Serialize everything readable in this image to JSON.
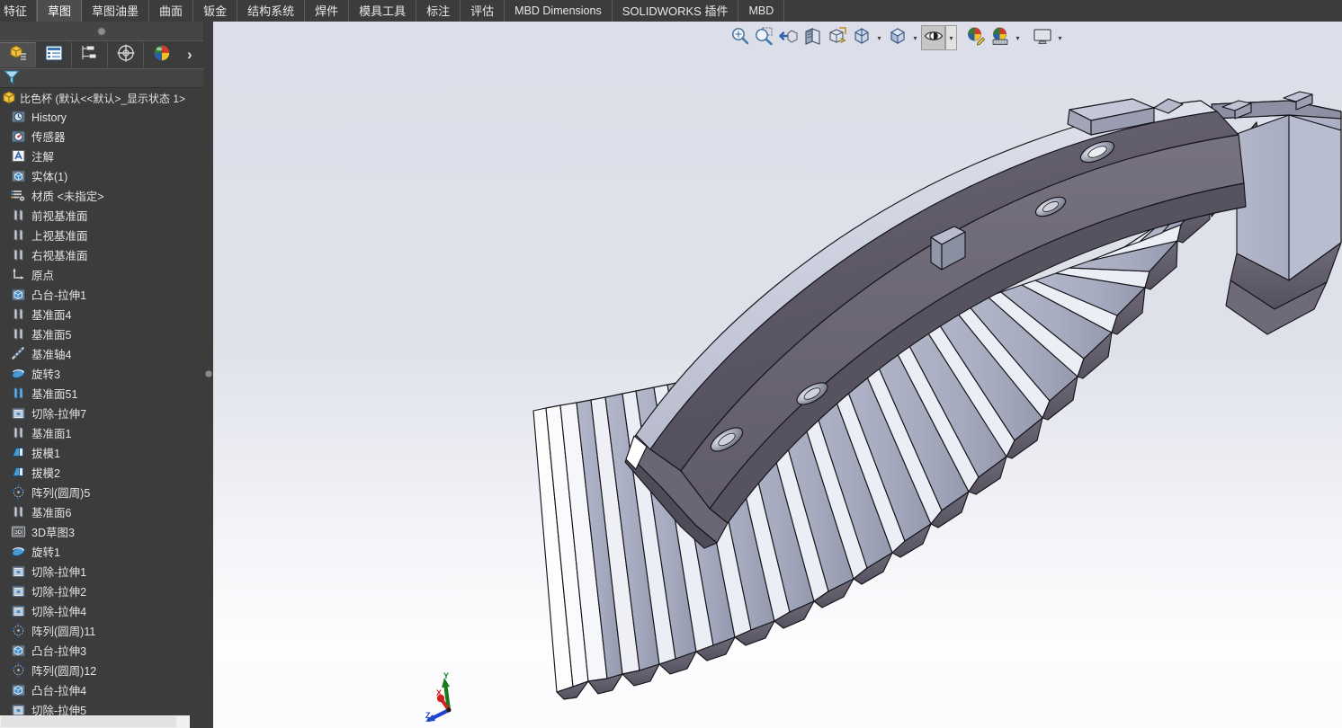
{
  "app": {
    "name": "SOLIDWORKS",
    "accent_blue": "#4a90d9",
    "panel_bg": "#3c3c3c",
    "viewport_top": "#dcdfe9",
    "viewport_bottom": "#fdfdfe",
    "model_dark": "#5f5a68",
    "model_light": "#adb1c5",
    "model_mid": "#8f93a8"
  },
  "ribbon": {
    "tabs": [
      {
        "label": "特征",
        "active": false,
        "script": "cjk"
      },
      {
        "label": "草图",
        "active": true,
        "script": "cjk"
      },
      {
        "label": "草图油墨",
        "active": false,
        "script": "cjk"
      },
      {
        "label": "曲面",
        "active": false,
        "script": "cjk"
      },
      {
        "label": "钣金",
        "active": false,
        "script": "cjk"
      },
      {
        "label": "结构系统",
        "active": false,
        "script": "cjk"
      },
      {
        "label": "焊件",
        "active": false,
        "script": "cjk"
      },
      {
        "label": "模具工具",
        "active": false,
        "script": "cjk"
      },
      {
        "label": "标注",
        "active": false,
        "script": "cjk"
      },
      {
        "label": "评估",
        "active": false,
        "script": "cjk"
      },
      {
        "label": "MBD Dimensions",
        "active": false,
        "script": "latin"
      },
      {
        "label": "SOLIDWORKS 插件",
        "active": false,
        "script": "mixed"
      },
      {
        "label": "MBD",
        "active": false,
        "script": "latin"
      }
    ]
  },
  "left_panel": {
    "tabs": [
      {
        "name": "feature-manager-design-tree-tab",
        "icon": "tree-icon",
        "active": true
      },
      {
        "name": "property-manager-tab",
        "icon": "property-list-icon",
        "active": false
      },
      {
        "name": "configuration-manager-tab",
        "icon": "configuration-icon",
        "active": false
      },
      {
        "name": "dimxpert-manager-tab",
        "icon": "dimxpert-icon",
        "active": false
      },
      {
        "name": "display-manager-tab",
        "icon": "display-sphere-icon",
        "active": false
      }
    ],
    "expand_label": "›",
    "filter_icon": "filter-funnel-icon",
    "tree": {
      "root": {
        "label": "比色杯  (默认<<默认>_显示状态 1>",
        "icon": "part-document-icon"
      },
      "items": [
        {
          "label": "History",
          "icon": "history-icon"
        },
        {
          "label": "传感器",
          "icon": "sensor-icon"
        },
        {
          "label": "注解",
          "icon": "annotation-icon"
        },
        {
          "label": "实体(1)",
          "icon": "solid-bodies-icon"
        },
        {
          "label": "材质 <未指定>",
          "icon": "material-icon"
        },
        {
          "label": "前视基准面",
          "icon": "plane-icon"
        },
        {
          "label": "上视基准面",
          "icon": "plane-icon"
        },
        {
          "label": "右视基准面",
          "icon": "plane-icon"
        },
        {
          "label": "原点",
          "icon": "origin-icon"
        },
        {
          "label": "凸台-拉伸1",
          "icon": "boss-extrude-icon"
        },
        {
          "label": "基准面4",
          "icon": "plane-icon"
        },
        {
          "label": "基准面5",
          "icon": "plane-icon"
        },
        {
          "label": "基准轴4",
          "icon": "axis-icon"
        },
        {
          "label": "旋转3",
          "icon": "revolve-icon"
        },
        {
          "label": "基准面51",
          "icon": "plane-blue-icon"
        },
        {
          "label": "切除-拉伸7",
          "icon": "cut-extrude-icon"
        },
        {
          "label": "基准面1",
          "icon": "plane-icon"
        },
        {
          "label": "拔模1",
          "icon": "draft-icon"
        },
        {
          "label": "拔模2",
          "icon": "draft-icon"
        },
        {
          "label": "阵列(圆周)5",
          "icon": "circular-pattern-icon"
        },
        {
          "label": "基准面6",
          "icon": "plane-icon"
        },
        {
          "label": "3D草图3",
          "icon": "sketch3d-icon"
        },
        {
          "label": "旋转1",
          "icon": "revolve-icon"
        },
        {
          "label": "切除-拉伸1",
          "icon": "cut-extrude-icon"
        },
        {
          "label": "切除-拉伸2",
          "icon": "cut-extrude-icon"
        },
        {
          "label": "切除-拉伸4",
          "icon": "cut-extrude-icon"
        },
        {
          "label": "阵列(圆周)11",
          "icon": "circular-pattern-icon"
        },
        {
          "label": "凸台-拉伸3",
          "icon": "boss-extrude-icon"
        },
        {
          "label": "阵列(圆周)12",
          "icon": "circular-pattern-icon"
        },
        {
          "label": "凸台-拉伸4",
          "icon": "boss-extrude-icon"
        },
        {
          "label": "切除-拉伸5",
          "icon": "cut-extrude-icon"
        }
      ]
    },
    "scrollbar": {
      "up_arrow": "▲",
      "down_arrow": "▼"
    }
  },
  "view_toolbar": {
    "buttons": [
      {
        "name": "zoom-to-fit-button",
        "icon": "zoom-to-fit-icon",
        "pressed": false,
        "dropdown": false
      },
      {
        "name": "zoom-to-area-button",
        "icon": "zoom-to-area-icon",
        "pressed": false,
        "dropdown": false
      },
      {
        "name": "previous-view-button",
        "icon": "previous-view-icon",
        "pressed": false,
        "dropdown": false
      },
      {
        "name": "section-view-button",
        "icon": "section-view-icon",
        "pressed": false,
        "dropdown": false
      },
      {
        "name": "view-orientation-button",
        "icon": "view-orientation-icon",
        "pressed": false,
        "dropdown": false
      },
      {
        "name": "display-style-button",
        "icon": "display-style-cube-icon",
        "pressed": false,
        "dropdown": true
      },
      {
        "name": "apply-scene-button",
        "icon": "display-style-shaded-icon",
        "pressed": false,
        "dropdown": true
      },
      {
        "name": "hide-show-items-button",
        "icon": "eye-hide-show-icon",
        "pressed": true,
        "dropdown": true
      },
      {
        "name": "edit-appearance-button",
        "icon": "appearance-pencil-icon",
        "pressed": false,
        "dropdown": false
      },
      {
        "name": "apply-scene-ball-button",
        "icon": "scene-ball-icon",
        "pressed": false,
        "dropdown": true
      },
      {
        "name": "view-settings-button",
        "icon": "monitor-icon",
        "pressed": false,
        "dropdown": true
      }
    ],
    "dropdown_glyph": "▾"
  },
  "viewport": {
    "triad": {
      "x_label": "X",
      "y_label": "Y",
      "z_label": "Z",
      "x_color": "#cc2222",
      "y_color": "#1a7a1a",
      "z_color": "#2244cc"
    },
    "model": {
      "name": "比色杯",
      "description": "curved finned part, isometric shaded view with edges",
      "vane_count": 18
    }
  }
}
